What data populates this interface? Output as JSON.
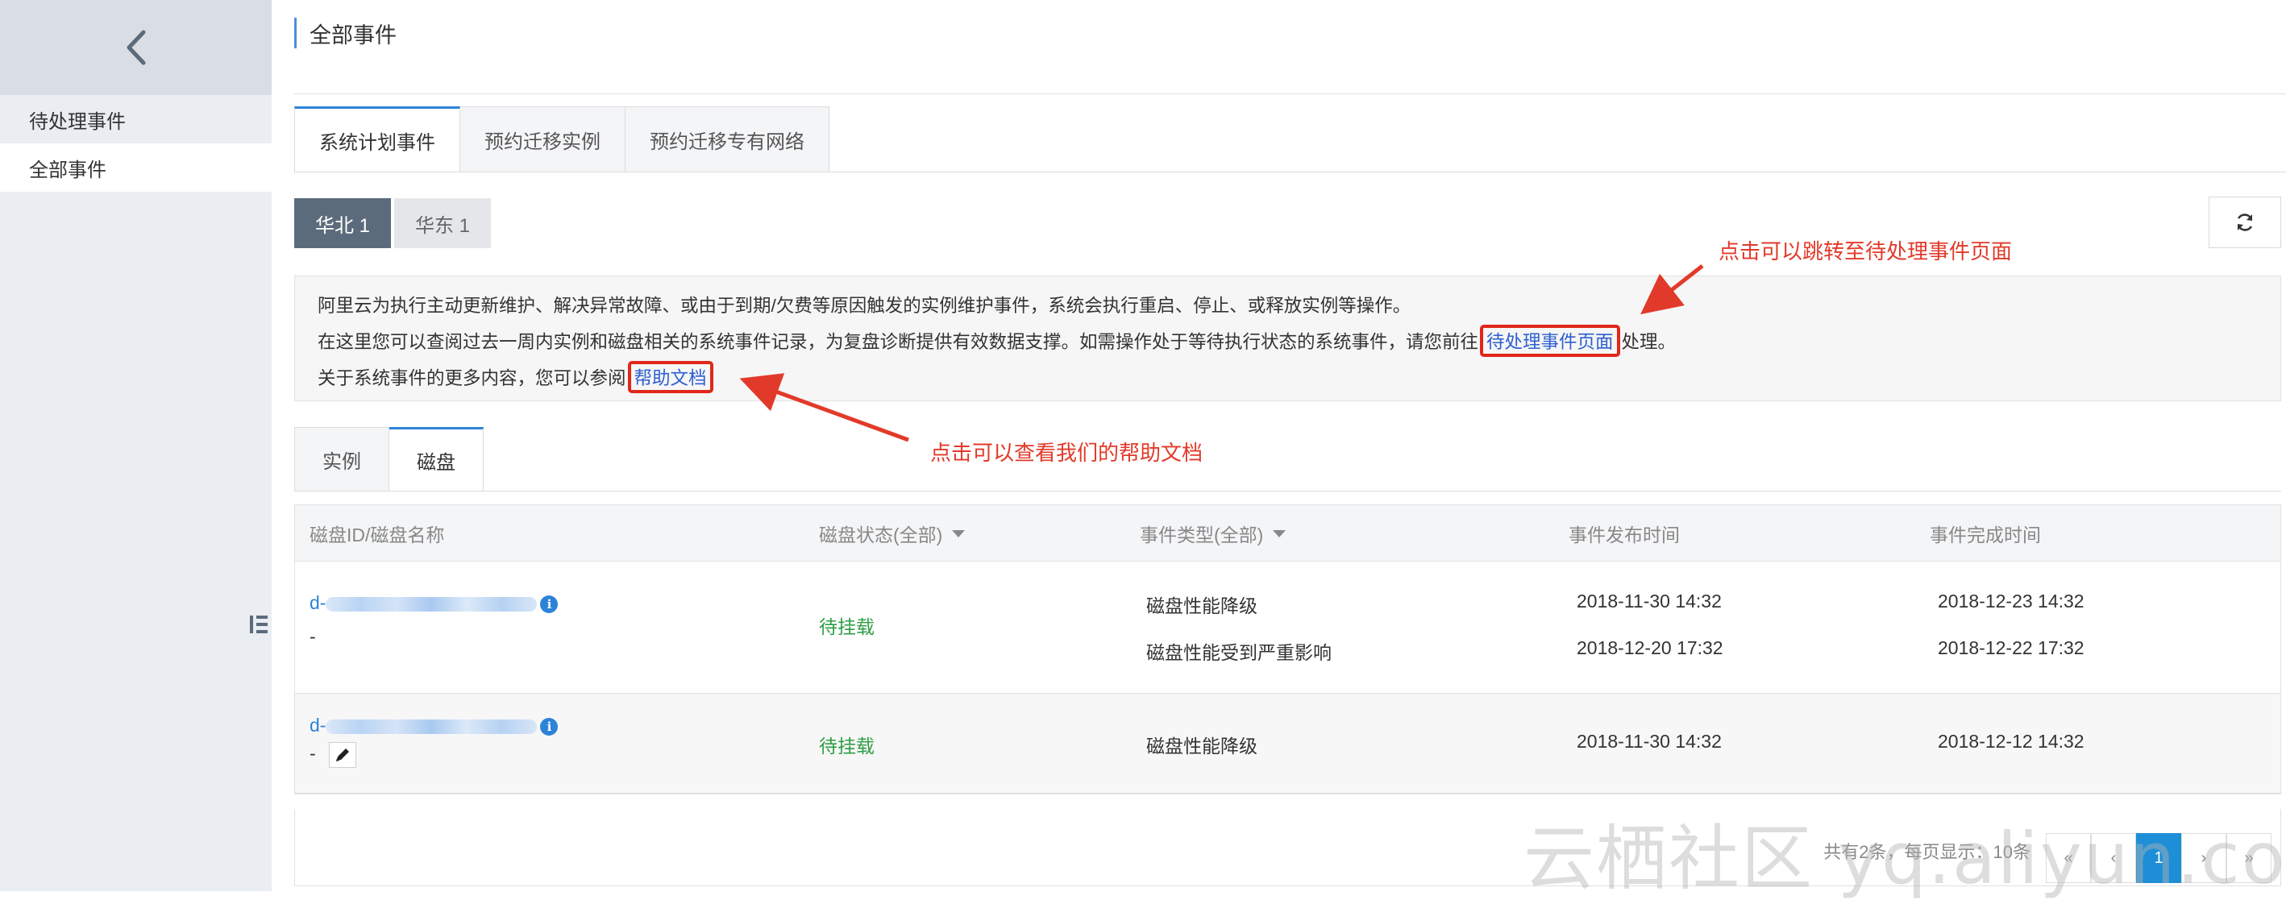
{
  "sidebar": {
    "items": [
      {
        "label": "待处理事件"
      },
      {
        "label": "全部事件"
      }
    ]
  },
  "page_title": "全部事件",
  "tabs": [
    {
      "label": "系统计划事件"
    },
    {
      "label": "预约迁移实例"
    },
    {
      "label": "预约迁移专有网络"
    }
  ],
  "regions": [
    {
      "label": "华北 1"
    },
    {
      "label": "华东 1"
    }
  ],
  "notice": {
    "line1": "阿里云为执行主动更新维护、解决异常故障、或由于到期/欠费等原因触发的实例维护事件，系统会执行重启、停止、或释放实例等操作。",
    "line2_prefix": "在这里您可以查阅过去一周内实例和磁盘相关的系统事件记录，为复盘诊断提供有效数据支撑。如需操作处于等待执行状态的系统事件，请您前往",
    "line2_link": "待处理事件页面",
    "line2_suffix": "处理。",
    "line3_prefix": "关于系统事件的更多内容，您可以参阅",
    "line3_link": "帮助文档"
  },
  "annotations": {
    "pending_page": "点击可以跳转至待处理事件页面",
    "help_doc": "点击可以查看我们的帮助文档"
  },
  "subtabs": [
    {
      "label": "实例"
    },
    {
      "label": "磁盘"
    }
  ],
  "table": {
    "headers": {
      "disk": "磁盘ID/磁盘名称",
      "status": "磁盘状态(全部)",
      "event_type": "事件类型(全部)",
      "publish_time": "事件发布时间",
      "finish_time": "事件完成时间"
    },
    "rows": [
      {
        "id_prefix": "d-",
        "name": "-",
        "status": "待挂载",
        "events": [
          {
            "type": "磁盘性能降级",
            "publish": "2018-11-30 14:32",
            "finish": "2018-12-23 14:32"
          },
          {
            "type": "磁盘性能受到严重影响",
            "publish": "2018-12-20 17:32",
            "finish": "2018-12-22 17:32"
          }
        ]
      },
      {
        "id_prefix": "d-",
        "name": "-",
        "status": "待挂载",
        "events": [
          {
            "type": "磁盘性能降级",
            "publish": "2018-11-30 14:32",
            "finish": "2018-12-12 14:32"
          }
        ]
      }
    ]
  },
  "pagination": {
    "summary": "共有2条，每页显示：10条",
    "first": "«",
    "prev": "‹",
    "current": "1",
    "next": "›",
    "last": "»"
  },
  "watermark": "云栖社区 yq.aliyun.com",
  "icons": {
    "back": "chevron-left-icon",
    "refresh": "refresh-icon",
    "info": "info-icon",
    "edit": "pencil-icon",
    "collapse": "list-collapse-icon"
  },
  "colors": {
    "accent": "#2d83d8",
    "status_green": "#2e9e44",
    "annotation_red": "#e23a2a",
    "region_active": "#5b6b7c"
  }
}
